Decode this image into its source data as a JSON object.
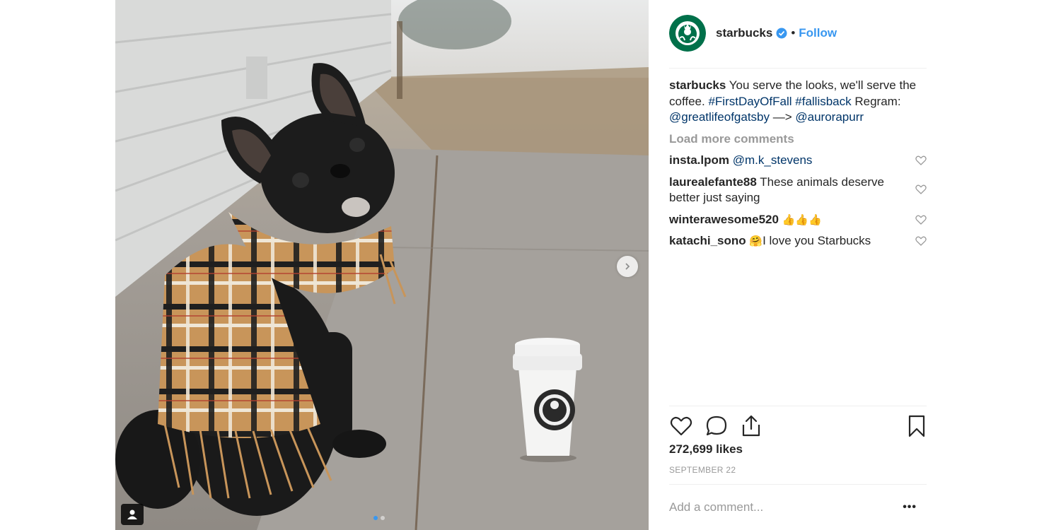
{
  "post": {
    "username": "starbucks",
    "verified": true,
    "follow_label": "Follow",
    "separator": "•",
    "caption": {
      "username": "starbucks",
      "text": " You serve the looks, we'll serve the coffee. ",
      "hashtag1": "#FirstDayOfFall",
      "hashtag2": "#fallisback",
      "regram_prefix": " Regram: ",
      "mention1": "@greatlifeofgatsby",
      "arrow": " —> ",
      "mention2": "@aurorapurr"
    },
    "load_more": "Load more comments",
    "comments": [
      {
        "username": "insta.lpom",
        "mention": "@m.k_stevens"
      },
      {
        "username": "laurealefante88",
        "text": " These animals deserve better just saying"
      },
      {
        "username": "winterawesome520",
        "emoji": "👍👍👍"
      },
      {
        "username": "katachi_sono",
        "emoji": "🤗",
        "text": "I love you Starbucks"
      }
    ],
    "likes": "272,699 likes",
    "date": "SEPTEMBER 22",
    "add_comment_placeholder": "Add a comment...",
    "more_options": "•••"
  },
  "icons": {
    "like": "heart-icon",
    "comment": "comment-bubble-icon",
    "share": "share-icon",
    "save": "bookmark-icon",
    "verified": "verified-badge-icon",
    "next": "chevron-right-icon",
    "tag": "user-tag-icon"
  },
  "colors": {
    "link_blue": "#003569",
    "follow_blue": "#3897f0",
    "starbucks_green": "#00704a",
    "muted": "#999999"
  }
}
